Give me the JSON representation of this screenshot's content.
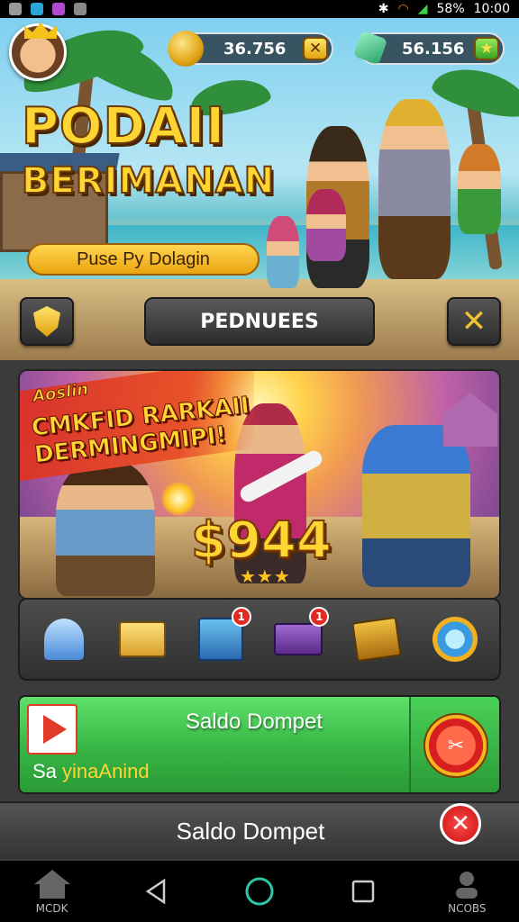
{
  "status_bar": {
    "battery": "58%",
    "time": "10:00"
  },
  "header": {
    "gold": {
      "value": "36.756",
      "btn": "✕"
    },
    "gems": {
      "value": "56.156",
      "btn": "★"
    }
  },
  "hero": {
    "title_line1": "PODAII",
    "title_line2": "BERIMANAN",
    "pill_label": "Puse Py Dolagin"
  },
  "toolbar": {
    "main_label": "PEDNUEES",
    "close_glyph": "✕"
  },
  "promo": {
    "small_label": "Aoslin",
    "headline_1": "CMKFID RARKAII",
    "headline_2": "DERMINGMIPI!",
    "price": "$944",
    "stars": "★★★"
  },
  "items": [
    {
      "name": "bell",
      "badge": ""
    },
    {
      "name": "package",
      "badge": ""
    },
    {
      "name": "crate",
      "badge": "1"
    },
    {
      "name": "cart",
      "badge": "1"
    },
    {
      "name": "chest",
      "badge": ""
    },
    {
      "name": "orb",
      "badge": ""
    }
  ],
  "wallet": {
    "title": "Saldo Dompet",
    "sub_prefix": "Sa ",
    "sub_highlight": "yinaAnind"
  },
  "bottom_bar": {
    "title": "Saldo Dompet",
    "close_glyph": "✕"
  },
  "nav": {
    "left_label": "MCDK",
    "right_label": "NCOBS"
  },
  "colors": {
    "gold": "#ffd534",
    "green": "#36b544",
    "red": "#e02a22"
  }
}
